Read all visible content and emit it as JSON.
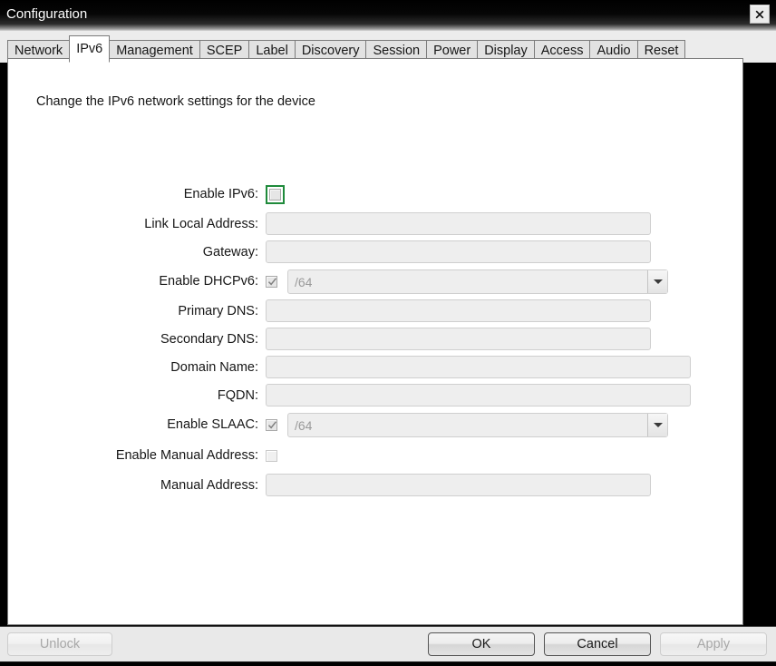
{
  "window": {
    "title": "Configuration",
    "close_icon": "close-icon"
  },
  "tabs": [
    {
      "label": "Network",
      "active": false
    },
    {
      "label": "IPv6",
      "active": true
    },
    {
      "label": "Management",
      "active": false
    },
    {
      "label": "SCEP",
      "active": false
    },
    {
      "label": "Label",
      "active": false
    },
    {
      "label": "Discovery",
      "active": false
    },
    {
      "label": "Session",
      "active": false
    },
    {
      "label": "Power",
      "active": false
    },
    {
      "label": "Display",
      "active": false
    },
    {
      "label": "Access",
      "active": false
    },
    {
      "label": "Audio",
      "active": false
    },
    {
      "label": "Reset",
      "active": false
    }
  ],
  "panel": {
    "description": "Change the IPv6 network settings for the device",
    "fields": {
      "enable_ipv6": {
        "label": "Enable IPv6:",
        "checked": false,
        "focused": true
      },
      "link_local_address": {
        "label": "Link Local Address:",
        "value": "",
        "placeholder": ""
      },
      "gateway": {
        "label": "Gateway:",
        "value": "",
        "placeholder": ""
      },
      "enable_dhcpv6": {
        "label": "Enable DHCPv6:",
        "checked": true,
        "prefix_value": "/64"
      },
      "primary_dns": {
        "label": "Primary DNS:",
        "value": "",
        "placeholder": ""
      },
      "secondary_dns": {
        "label": "Secondary DNS:",
        "value": "",
        "placeholder": ""
      },
      "domain_name": {
        "label": "Domain Name:",
        "value": "",
        "placeholder": ""
      },
      "fqdn": {
        "label": "FQDN:",
        "value": "",
        "placeholder": ""
      },
      "enable_slaac": {
        "label": "Enable SLAAC:",
        "checked": true,
        "prefix_value": "/64"
      },
      "enable_manual_address": {
        "label": "Enable Manual Address:",
        "checked": false
      },
      "manual_address": {
        "label": "Manual Address:",
        "value": "",
        "placeholder": ""
      }
    }
  },
  "buttons": {
    "unlock": {
      "label": "Unlock",
      "enabled": false
    },
    "ok": {
      "label": "OK",
      "enabled": true
    },
    "cancel": {
      "label": "Cancel",
      "enabled": true
    },
    "apply": {
      "label": "Apply",
      "enabled": false
    }
  },
  "colors": {
    "focus_ring": "#1f8a3b",
    "titlebar_text": "#ffffff",
    "panel_background": "#ffffff",
    "chrome_background": "#ececec"
  }
}
